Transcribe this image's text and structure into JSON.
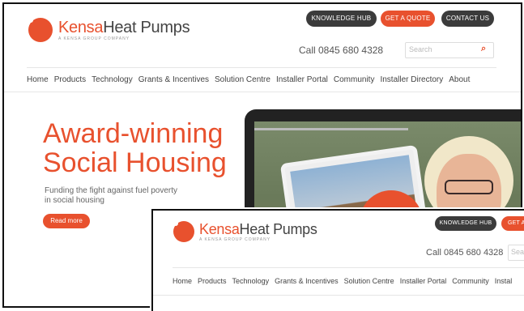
{
  "brand": {
    "name_a": "Kensa",
    "name_b": "Heat Pumps",
    "tagline": "A Kensa Group Company"
  },
  "header": {
    "buttons": {
      "knowledge": "KNOWLEDGE HUB",
      "quote": "GET A QUOTE",
      "contact": "CONTACT US"
    },
    "phone": "Call 0845 680 4328",
    "search": {
      "placeholder": "Search",
      "icon": "search-icon"
    }
  },
  "nav": [
    "Home",
    "Products",
    "Technology",
    "Grants & Incentives",
    "Solution Centre",
    "Installer Portal",
    "Community",
    "Installer Directory",
    "About"
  ],
  "hero": {
    "title_line1": "Award-winning",
    "title_line2": "Social Housing",
    "subtitle_line1": "Funding the fight against fuel poverty",
    "subtitle_line2": "in social housing",
    "button": "Read more",
    "play_icon": "play-icon"
  },
  "second": {
    "buttons": {
      "knowledge": "KNOWLEDGE HUB",
      "quote_partial": "GET A"
    },
    "phone": "Call 0845 680 4328",
    "search_partial": "Sea",
    "nav": [
      "Home",
      "Products",
      "Technology",
      "Grants & Incentives",
      "Solution Centre",
      "Installer Portal",
      "Community",
      "Instal"
    ]
  },
  "colors": {
    "accent": "#e8512e",
    "dark_button": "#3b3b3b",
    "text": "#444444"
  }
}
